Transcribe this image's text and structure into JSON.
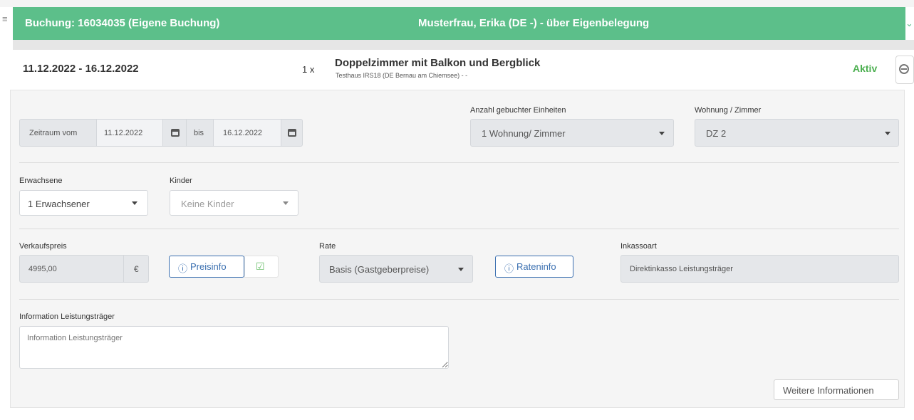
{
  "header": {
    "booking_title": "Buchung: 16034035 (Eigene Buchung)",
    "guest_info": "Musterfrau, Erika (DE -) - über Eigenbelegung"
  },
  "booking_row": {
    "date_range": "11.12.2022 - 16.12.2022",
    "quantity": "1 x",
    "room_name": "Doppelzimmer mit Balkon und Bergblick",
    "house_info": "Testhaus IRS18 (DE Bernau am Chiemsee) - -",
    "status": "Aktiv",
    "status_color": "#4caf50"
  },
  "form": {
    "period": {
      "from_label": "Zeitraum vom",
      "from_value": "11.12.2022",
      "to_label": "bis",
      "to_value": "16.12.2022"
    },
    "units": {
      "label": "Anzahl gebuchter Einheiten",
      "value": "1 Wohnung/ Zimmer"
    },
    "room": {
      "label": "Wohnung / Zimmer",
      "value": "DZ 2"
    },
    "adults": {
      "label": "Erwachsene",
      "value": "1 Erwachsener"
    },
    "children": {
      "label": "Kinder",
      "value": "Keine Kinder"
    },
    "price": {
      "label": "Verkaufspreis",
      "value": "4995,00",
      "currency": "€",
      "info_button": "Preisinfo"
    },
    "rate": {
      "label": "Rate",
      "value": "Basis (Gastgeberpreise)",
      "info_button": "Rateninfo"
    },
    "collection": {
      "label": "Inkassoart",
      "value": "Direktinkasso Leistungsträger"
    },
    "provider_info": {
      "label": "Information Leistungsträger",
      "placeholder": "Information Leistungsträger"
    },
    "more_button": "Weitere Informationen"
  },
  "colors": {
    "header_green": "#5cbf8a",
    "link_blue": "#3a6fb0"
  }
}
